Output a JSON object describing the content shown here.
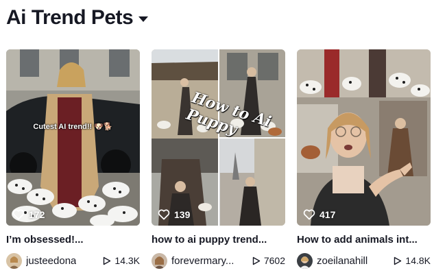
{
  "header": {
    "title": "Ai Trend Pets",
    "caret_icon": "chevron-down-icon"
  },
  "cards": [
    {
      "likes": "172",
      "overlay_text": "Cutest AI trend!! 🐶🐕",
      "title": "I’m obsessed!...",
      "username": "justeedona",
      "plays": "14.3K"
    },
    {
      "likes": "139",
      "overlay_text": "How to Ai Puppy",
      "title": "how to ai puppy trend...",
      "username": "forevermary...",
      "plays": "7602"
    },
    {
      "likes": "417",
      "title": "How to add animals int...",
      "username": "zoeilanahill",
      "plays": "14.8K"
    }
  ],
  "colors": {
    "text": "#161823",
    "background": "#ffffff"
  }
}
